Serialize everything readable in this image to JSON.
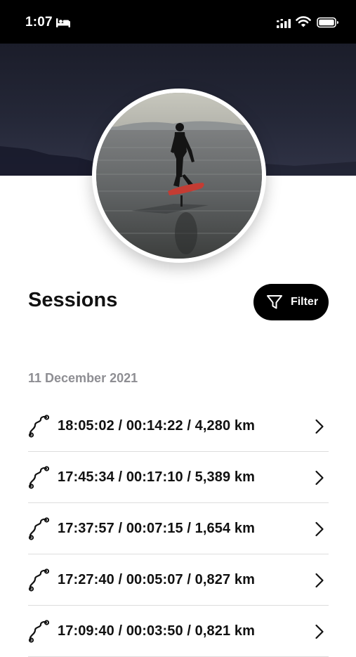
{
  "status_bar": {
    "time": "1:07",
    "icons": [
      "bed-icon",
      "cellular-signal-icon",
      "wifi-icon",
      "battery-icon"
    ]
  },
  "profile": {
    "avatar_icon": "surfer-photo"
  },
  "sessions": {
    "title": "Sessions",
    "filter_label": "Filter",
    "filter_icon": "funnel-icon",
    "date_groups": [
      {
        "date": "11 December 2021",
        "items": [
          {
            "label": "18:05:02 / 00:14:22 / 4,280 km"
          },
          {
            "label": "17:45:34 / 00:17:10 / 5,389 km"
          },
          {
            "label": "17:37:57 / 00:07:15 / 1,654 km"
          },
          {
            "label": "17:27:40 / 00:05:07 / 0,827 km"
          },
          {
            "label": "17:09:40 / 00:03:50 / 0,821 km"
          }
        ]
      }
    ]
  },
  "colors": {
    "accent": "#000000",
    "text": "#111111",
    "muted": "#8e8e93",
    "divider": "#dddddd",
    "hero": "#242737"
  }
}
